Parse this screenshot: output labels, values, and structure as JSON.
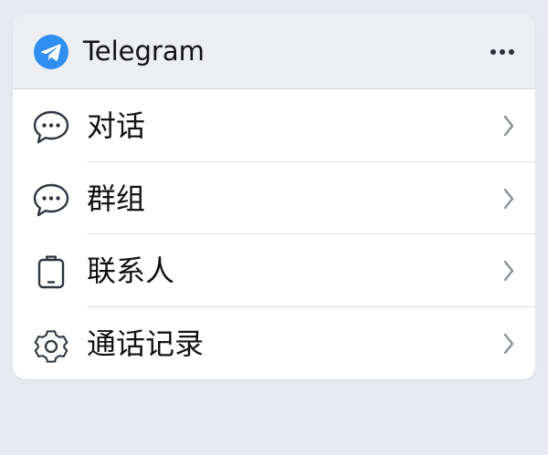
{
  "app": {
    "name": "Telegram",
    "icon": "telegram-paper-plane-icon",
    "brand_color": "#2f8ff0"
  },
  "header": {
    "more_icon": "ellipsis-icon"
  },
  "menu": {
    "items": [
      {
        "label": "对话",
        "icon": "chat-bubble-icon"
      },
      {
        "label": "群组",
        "icon": "chat-bubble-icon"
      },
      {
        "label": "联系人",
        "icon": "phone-device-icon"
      },
      {
        "label": "通话记录",
        "icon": "gear-icon"
      }
    ],
    "chevron_icon": "chevron-right-icon",
    "icon_color": "#2e3440",
    "chevron_color": "#8b9097"
  }
}
